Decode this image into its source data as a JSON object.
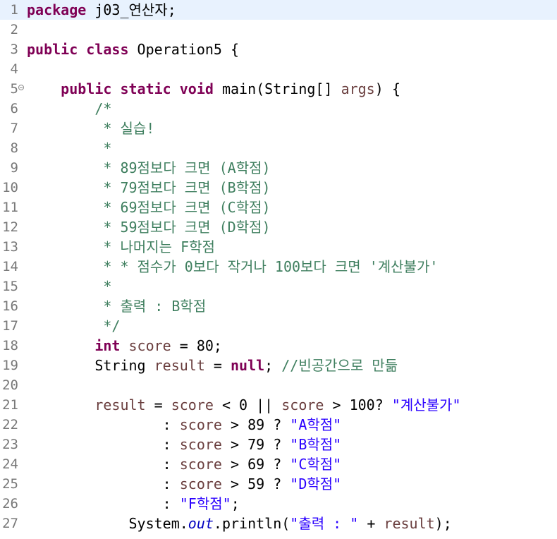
{
  "editor": {
    "lines": [
      {
        "n": "1",
        "tokens": [
          [
            "kw",
            "package"
          ],
          [
            "op",
            " j03_연산자;"
          ]
        ]
      },
      {
        "n": "2",
        "tokens": []
      },
      {
        "n": "3",
        "tokens": [
          [
            "kw",
            "public"
          ],
          [
            "op",
            " "
          ],
          [
            "kw",
            "class"
          ],
          [
            "op",
            " Operation5 {"
          ]
        ]
      },
      {
        "n": "4",
        "tokens": []
      },
      {
        "n": "5",
        "tokens": [
          [
            "op",
            "    "
          ],
          [
            "kw",
            "public"
          ],
          [
            "op",
            " "
          ],
          [
            "kw",
            "static"
          ],
          [
            "op",
            " "
          ],
          [
            "kw",
            "void"
          ],
          [
            "op",
            " main(String[] "
          ],
          [
            "var",
            "args"
          ],
          [
            "op",
            ") {"
          ]
        ],
        "fold": true
      },
      {
        "n": "6",
        "tokens": [
          [
            "cm",
            "        /*"
          ]
        ]
      },
      {
        "n": "7",
        "tokens": [
          [
            "cm",
            "         * 실습!"
          ]
        ]
      },
      {
        "n": "8",
        "tokens": [
          [
            "cm",
            "         *"
          ]
        ]
      },
      {
        "n": "9",
        "tokens": [
          [
            "cm",
            "         * 89점보다 크면 (A학점)"
          ]
        ]
      },
      {
        "n": "10",
        "tokens": [
          [
            "cm",
            "         * 79점보다 크면 (B학점)"
          ]
        ]
      },
      {
        "n": "11",
        "tokens": [
          [
            "cm",
            "         * 69점보다 크면 (C학점)"
          ]
        ]
      },
      {
        "n": "12",
        "tokens": [
          [
            "cm",
            "         * 59점보다 크면 (D학점)"
          ]
        ]
      },
      {
        "n": "13",
        "tokens": [
          [
            "cm",
            "         * 나머지는 F학점"
          ]
        ]
      },
      {
        "n": "14",
        "tokens": [
          [
            "cm",
            "         * * 점수가 0보다 작거나 100보다 크면 '계산불가'"
          ]
        ]
      },
      {
        "n": "15",
        "tokens": [
          [
            "cm",
            "         *"
          ]
        ]
      },
      {
        "n": "16",
        "tokens": [
          [
            "cm",
            "         * 출력 : B학점"
          ]
        ]
      },
      {
        "n": "17",
        "tokens": [
          [
            "cm",
            "         */"
          ]
        ]
      },
      {
        "n": "18",
        "tokens": [
          [
            "op",
            "        "
          ],
          [
            "kw",
            "int"
          ],
          [
            "op",
            " "
          ],
          [
            "var",
            "score"
          ],
          [
            "op",
            " = 80;"
          ]
        ]
      },
      {
        "n": "19",
        "tokens": [
          [
            "op",
            "        String "
          ],
          [
            "var",
            "result"
          ],
          [
            "op",
            " = "
          ],
          [
            "kw",
            "null"
          ],
          [
            "op",
            "; "
          ],
          [
            "cm",
            "//빈공간으로 만듦"
          ]
        ]
      },
      {
        "n": "20",
        "tokens": []
      },
      {
        "n": "21",
        "tokens": [
          [
            "op",
            "        "
          ],
          [
            "var",
            "result"
          ],
          [
            "op",
            " = "
          ],
          [
            "var",
            "score"
          ],
          [
            "op",
            " < 0 || "
          ],
          [
            "var",
            "score"
          ],
          [
            "op",
            " > 100? "
          ],
          [
            "str",
            "\"계산불가\""
          ]
        ]
      },
      {
        "n": "22",
        "tokens": [
          [
            "op",
            "                : "
          ],
          [
            "var",
            "score"
          ],
          [
            "op",
            " > 89 ? "
          ],
          [
            "str",
            "\"A학점\""
          ]
        ]
      },
      {
        "n": "23",
        "tokens": [
          [
            "op",
            "                : "
          ],
          [
            "var",
            "score"
          ],
          [
            "op",
            " > 79 ? "
          ],
          [
            "str",
            "\"B학점\""
          ]
        ]
      },
      {
        "n": "24",
        "tokens": [
          [
            "op",
            "                : "
          ],
          [
            "var",
            "score"
          ],
          [
            "op",
            " > 69 ? "
          ],
          [
            "str",
            "\"C학점\""
          ]
        ]
      },
      {
        "n": "25",
        "tokens": [
          [
            "op",
            "                : "
          ],
          [
            "var",
            "score"
          ],
          [
            "op",
            " > 59 ? "
          ],
          [
            "str",
            "\"D학점\""
          ]
        ]
      },
      {
        "n": "26",
        "tokens": [
          [
            "op",
            "                : "
          ],
          [
            "str",
            "\"F학점\""
          ],
          [
            "op",
            ";"
          ]
        ]
      },
      {
        "n": "27",
        "tokens": [
          [
            "op",
            "            System."
          ],
          [
            "fld",
            "out"
          ],
          [
            "op",
            ".println("
          ],
          [
            "str",
            "\"출력 : \""
          ],
          [
            "op",
            " + "
          ],
          [
            "var",
            "result"
          ],
          [
            "op",
            ");"
          ]
        ]
      }
    ],
    "current_line": "1"
  }
}
